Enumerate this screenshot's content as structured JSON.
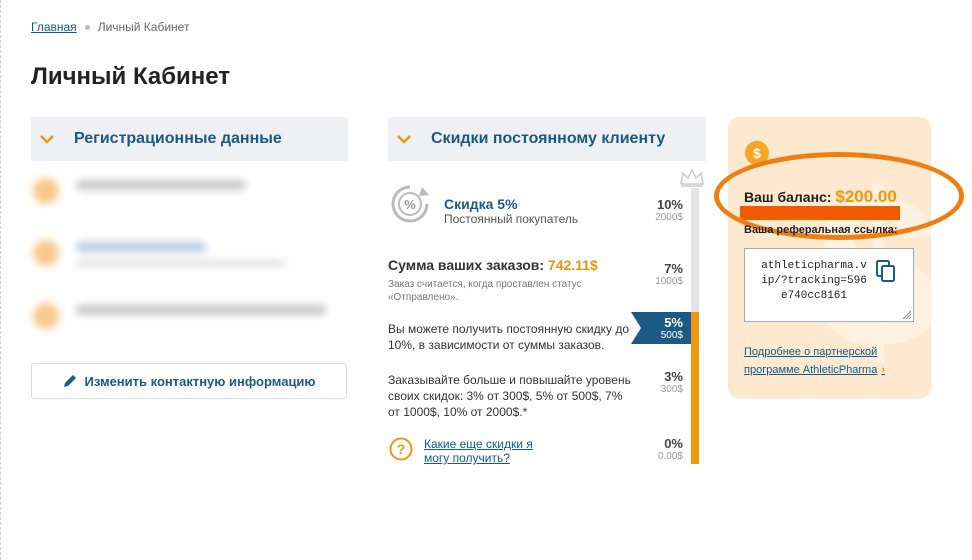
{
  "breadcrumb": {
    "home": "Главная",
    "current": "Личный Кабинет"
  },
  "page_title": "Личный Кабинет",
  "registration": {
    "title": "Регистрационные данные",
    "edit_button": "Изменить контактную информацию"
  },
  "discounts": {
    "title": "Скидки постоянному клиенту",
    "current_discount": "Скидка 5%",
    "customer_status": "Постоянный покупатель",
    "orders_sum_label": "Сумма ваших заказов:",
    "orders_sum_value": "742.11$",
    "orders_note": "Заказ считается, когда проставлен статус «Отправлено».",
    "info_max": "Вы можете получить постоянную скидку до 10%, в зависимости от суммы заказов.",
    "info_levels": "Заказывайте больше и повышайте уровень своих скидок: 3% от 300$, 5% от 500$, 7% от 1000$, 10% от 2000$.*",
    "more_link": "Какие еще скидки я могу получить?",
    "scale": [
      {
        "pct": "10%",
        "amount": "2000$"
      },
      {
        "pct": "7%",
        "amount": "1000$"
      },
      {
        "pct": "5%",
        "amount": "500$"
      },
      {
        "pct": "3%",
        "amount": "300$"
      },
      {
        "pct": "0%",
        "amount": "0.00$"
      }
    ],
    "current_level_index": 2
  },
  "balance": {
    "label": "Ваш баланс:",
    "value": "$200.00",
    "coin_symbol": "$",
    "referral_label": "Ваша реферальная ссылка:",
    "referral_link": "athleticpharma.vip/?tracking=596e740cc8161",
    "partner_link": "Подробнее о партнерской программе AthleticPharma",
    "partner_arrow": "›"
  },
  "colors": {
    "accent_orange": "#f0960f",
    "link_blue": "#0d5c8c",
    "heading_blue": "#1c5a86",
    "tag_blue": "#1c5a86",
    "highlight_ring": "#f07d10"
  },
  "icons": [
    "chevron-down-icon",
    "percent-badge-icon",
    "crown-icon",
    "question-icon",
    "pencil-icon",
    "dollar-coin-icon",
    "copy-icon"
  ]
}
